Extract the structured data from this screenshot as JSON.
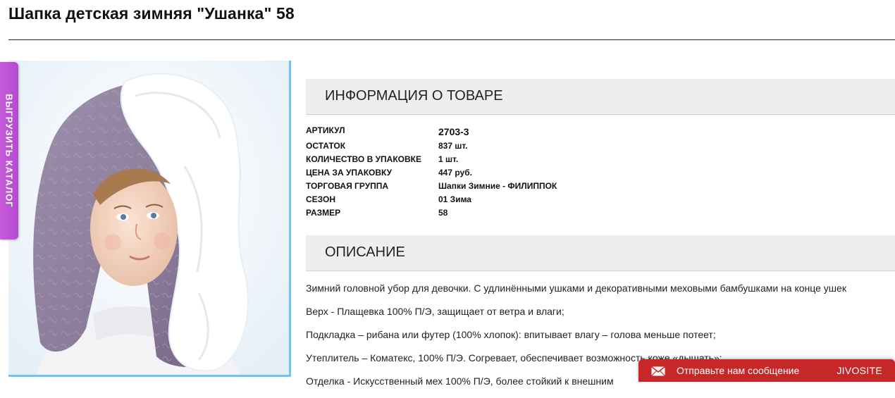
{
  "product": {
    "title": "Шапка детская зимняя \"Ушанка\" 58"
  },
  "catalog_tab": {
    "label": "ВЫГРУЗИТЬ КАТАЛОГ"
  },
  "info": {
    "header": "ИНФОРМАЦИЯ О ТОВАРЕ",
    "rows": [
      {
        "label": "АРТИКУЛ",
        "value": "2703-3"
      },
      {
        "label": "ОСТАТОК",
        "value": "837 шт."
      },
      {
        "label": "КОЛИЧЕСТВО В УПАКОВКЕ",
        "value": "1 шт."
      },
      {
        "label": "ЦЕНА ЗА УПАКОВКУ",
        "value": "447 руб."
      },
      {
        "label": "ТОРГОВАЯ ГРУППА",
        "value": "Шапки Зимние - ФИЛИППОК"
      },
      {
        "label": "СЕЗОН",
        "value": "01 Зима"
      },
      {
        "label": "РАЗМЕР",
        "value": "58"
      }
    ]
  },
  "description": {
    "header": "ОПИСАНИЕ",
    "paragraphs": [
      "Зимний головной убор для девочки. С удлинёнными ушками и декоративными меховыми бамбушками на конце ушек",
      "Верх - Плащевка 100% П/Э, защищает от ветра и влаги;",
      "Подкладка – рибана или футер (100% хлопок): впитывает влагу – голова меньше потеет;",
      "Утеплитель – Коматекс, 100% П/Э. Согревает, обеспечивает возможность коже «дышать»;",
      "Отделка - Искусственный мех 100% П/Э, более стойкий к внешним"
    ]
  },
  "chat_widget": {
    "text": "Отправьте нам сообщение",
    "brand": "JIVOSITE"
  },
  "colors": {
    "chat_red": "#c62828",
    "catalog_purple": "#c65cd9",
    "photo_border": "#6cc6ee",
    "section_bg": "#eeeeee"
  }
}
